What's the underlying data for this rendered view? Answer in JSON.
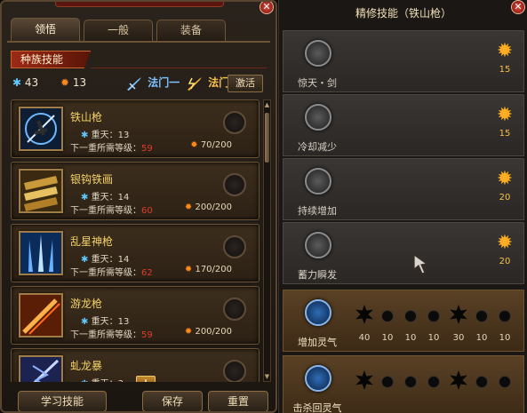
{
  "left": {
    "tabs": [
      "领悟",
      "一般",
      "装备"
    ],
    "active_tab": "领悟",
    "race_skill_title": "种族技能",
    "stats": {
      "blue_points": "43",
      "orange_points": "13"
    },
    "school_one": "法门一",
    "school_two": "法门二",
    "activate_label": "激活",
    "level_prefix": "重天：",
    "req_prefix": "下一重所需等级：",
    "skills": [
      {
        "name": "铁山枪",
        "level": "13",
        "req": "59",
        "cost": "70/200"
      },
      {
        "name": "银钩铁画",
        "level": "14",
        "req": "60",
        "cost": "200/200"
      },
      {
        "name": "乱星神枪",
        "level": "14",
        "req": "62",
        "cost": "170/200"
      },
      {
        "name": "游龙枪",
        "level": "13",
        "req": "59",
        "cost": "200/200"
      },
      {
        "name": "虬龙暴",
        "level": "3",
        "req": "",
        "cost": ""
      }
    ],
    "buttons": {
      "learn": "学习技能",
      "save": "保存",
      "reset": "重置"
    }
  },
  "right": {
    "title": "精修技能（铁山枪）",
    "rows": [
      {
        "name": "惊天・剑",
        "value": "15"
      },
      {
        "name": "冷却减少",
        "value": "15"
      },
      {
        "name": "持续增加",
        "value": "20"
      },
      {
        "name": "蓄力瞬发",
        "value": "20"
      }
    ],
    "gold_rows": [
      {
        "name": "增加灵气",
        "values": [
          "40",
          "10",
          "10",
          "10",
          "30",
          "10",
          "10"
        ]
      },
      {
        "name": "击杀回灵气",
        "values": []
      }
    ]
  },
  "colors": {
    "accent_gold": "#f5d36a",
    "req_red": "#e03b2a",
    "banner_red": "#9c2a15"
  }
}
